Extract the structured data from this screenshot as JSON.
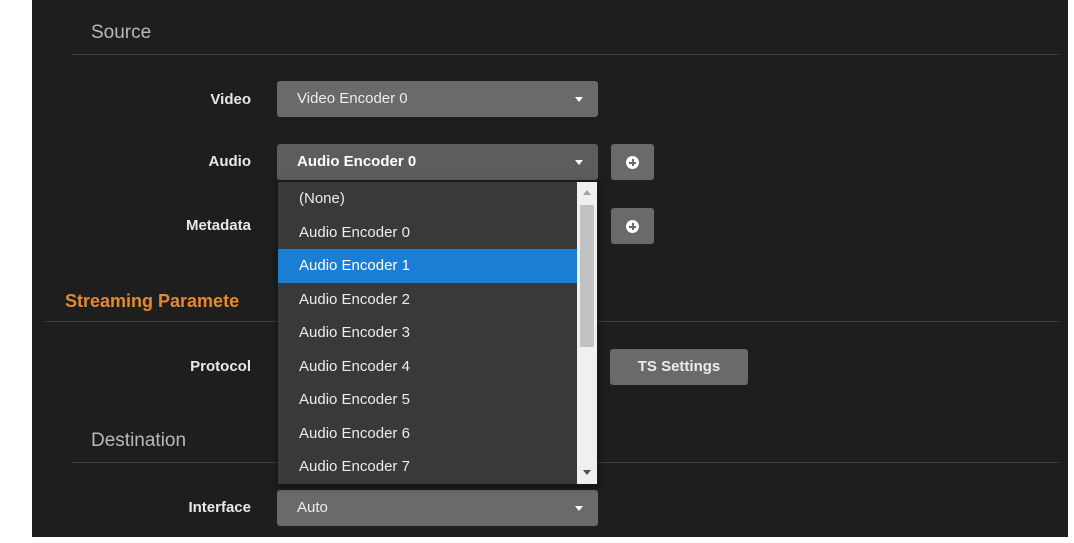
{
  "source": {
    "title": "Source",
    "video": {
      "label": "Video",
      "value": "Video Encoder 0"
    },
    "audio": {
      "label": "Audio",
      "value": "Audio Encoder 0"
    },
    "metadata": {
      "label": "Metadata"
    }
  },
  "streaming": {
    "title": "Streaming Paramete",
    "protocol": {
      "label": "Protocol",
      "ts_settings_label": "TS Settings"
    }
  },
  "destination": {
    "title": "Destination",
    "interface": {
      "label": "Interface",
      "value": "Auto"
    }
  },
  "dropdown": {
    "options": [
      "(None)",
      "Audio Encoder 0",
      "Audio Encoder 1",
      "Audio Encoder 2",
      "Audio Encoder 3",
      "Audio Encoder 4",
      "Audio Encoder 5",
      "Audio Encoder 6",
      "Audio Encoder 7"
    ],
    "highlighted": "Audio Encoder 1"
  },
  "colors": {
    "accent": "#e3892e",
    "highlight": "#1a7ed3",
    "background": "#1e1e1e",
    "control": "#6a6a6a"
  },
  "icons": [
    "plus-circle-icon",
    "chevron-down-icon",
    "scroll-up-icon",
    "scroll-down-icon"
  ]
}
